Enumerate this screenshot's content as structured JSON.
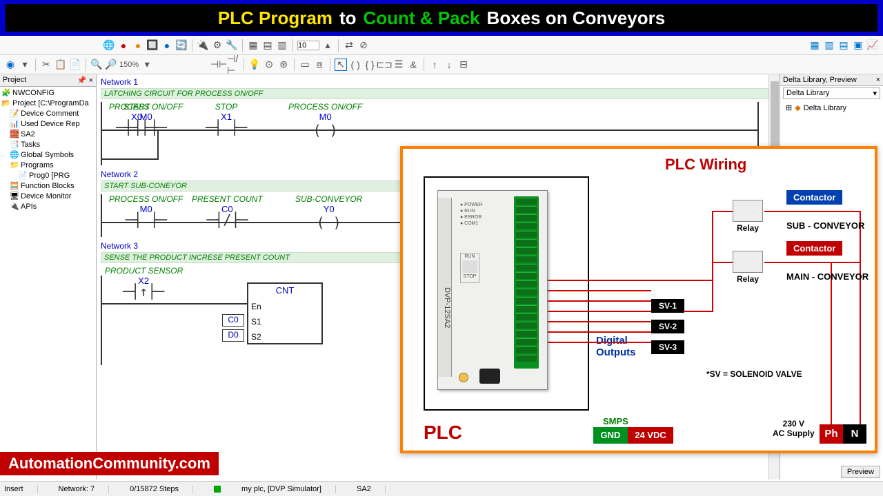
{
  "banner": {
    "w1": "PLC Program",
    "w2": "to",
    "w3": "Count & Pack",
    "w4": "Boxes on Conveyors"
  },
  "toolbar": {
    "zoom": "150%",
    "spin": "10"
  },
  "project": {
    "title": "Project",
    "items": [
      {
        "icon": "🧩",
        "label": "NWCONFIG",
        "cls": ""
      },
      {
        "icon": "📂",
        "label": "Project [C:\\ProgramDa",
        "cls": ""
      },
      {
        "icon": "📝",
        "label": "Device Comment",
        "cls": "indent-1"
      },
      {
        "icon": "📊",
        "label": "Used Device Rep",
        "cls": "indent-1"
      },
      {
        "icon": "🧱",
        "label": "SA2",
        "cls": "indent-1"
      },
      {
        "icon": "📑",
        "label": "Tasks",
        "cls": "indent-1"
      },
      {
        "icon": "🌐",
        "label": "Global Symbols",
        "cls": "indent-1"
      },
      {
        "icon": "📁",
        "label": "Programs",
        "cls": "indent-1"
      },
      {
        "icon": "📄",
        "label": "Prog0 [PRG",
        "cls": "indent-2"
      },
      {
        "icon": "🧮",
        "label": "Function Blocks",
        "cls": "indent-1"
      },
      {
        "icon": "🖥",
        "label": "Device Monitor",
        "cls": "indent-1"
      },
      {
        "icon": "🔌",
        "label": "APIs",
        "cls": "indent-1"
      }
    ]
  },
  "lib": {
    "title": "Delta Library, Preview",
    "combo": "Delta Library",
    "item": "Delta Library"
  },
  "net1": {
    "title": "Network 1",
    "comment": "LATCHING CIRCUIT FOR PROCESS ON/OFF",
    "e1l": "START",
    "e1t": "X0",
    "e2l": "STOP",
    "e2t": "X1",
    "e3l": "PROCESS ON/OFF",
    "e3t": "M0",
    "b1l": "PROCESS ON/OFF",
    "b1t": "M0"
  },
  "net2": {
    "title": "Network 2",
    "comment": "START SUB-CONEYOR",
    "e1l": "PROCESS ON/OFF",
    "e1t": "M0",
    "e2l": "PRESENT COUNT",
    "e2t": "C0",
    "e3l": "SUB-CONVEYOR",
    "e3t": "Y0"
  },
  "net3": {
    "title": "Network 3",
    "comment": "SENSE THE PRODUCT INCRESE PRESENT COUNT",
    "e1l": "PRODUCT SENSOR",
    "e1t": "X2",
    "fb": "CNT",
    "p1": "En",
    "p2": "S1",
    "p3": "S2",
    "v2": "C0",
    "v3": "D0"
  },
  "wiring": {
    "title": "PLC Wiring",
    "plc": "PLC",
    "model": "DVP-12SA2",
    "digout": "Digital\nOutputs",
    "sv1": "SV-1",
    "sv2": "SV-2",
    "sv3": "SV-3",
    "relay": "Relay",
    "cont": "Contactor",
    "sub": "SUB - CONVEYOR",
    "main": "MAIN - CONVEYOR",
    "note": "*SV = SOLENOID VALVE",
    "smps": "SMPS",
    "gnd": "GND",
    "vdc": "24 VDC",
    "ac": "230 V\nAC Supply",
    "ph": "Ph",
    "n": "N",
    "leds": "● POWER\n● RUN\n● ERROR\n● COM1",
    "run": "RUN",
    "stop": "STOP"
  },
  "brand": "AutomationCommunity.com",
  "status": {
    "a": "Insert",
    "b": "Network: 7",
    "c": "0/15872 Steps",
    "d": "my plc, [DVP Simulator]",
    "e": "SA2"
  },
  "preview": "Preview"
}
